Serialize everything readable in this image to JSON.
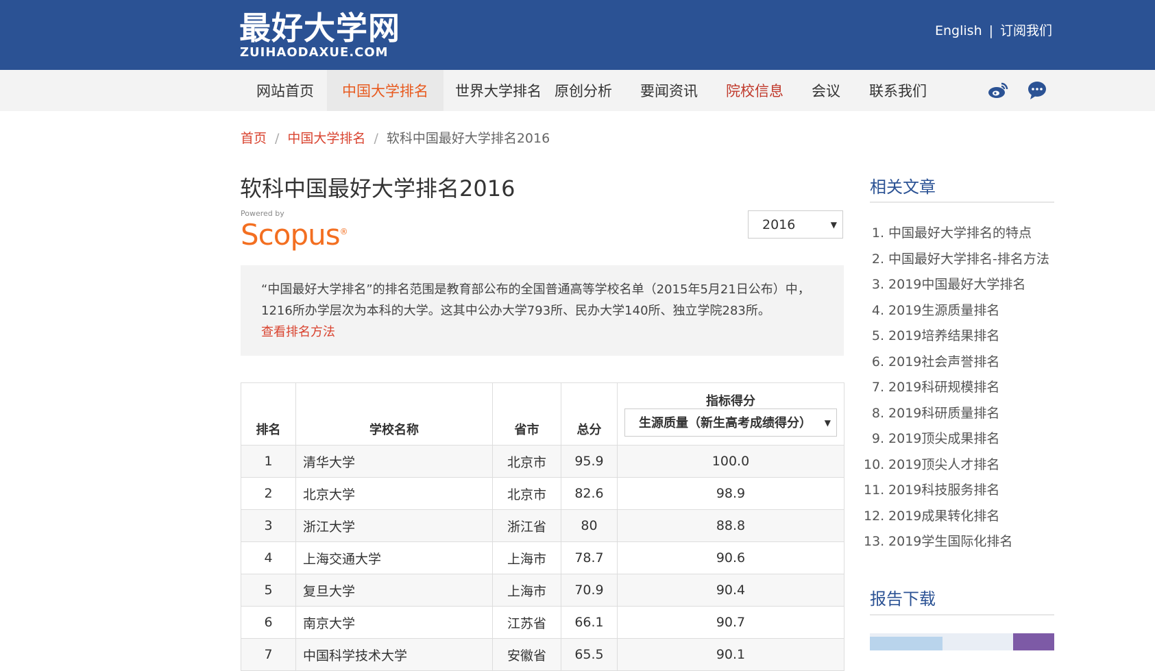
{
  "header": {
    "logo_cn": "最好大学网",
    "logo_en": "ZUIHAODAXUE.COM",
    "link_english": "English",
    "separator": "|",
    "link_subscribe": "订阅我们"
  },
  "nav": {
    "items": [
      "网站首页",
      "中国大学排名",
      "世界大学排名",
      "原创分析",
      "要闻资讯",
      "院校信息",
      "会议",
      "联系我们"
    ],
    "active_index": 1
  },
  "breadcrumb": {
    "home": "首页",
    "category": "中国大学排名",
    "current": "软科中国最好大学排名2016",
    "sep": "/"
  },
  "page": {
    "title": "软科中国最好大学排名2016",
    "powered_by": "Powered by",
    "scopus": "Scopus",
    "year_selected": "2016"
  },
  "intro": {
    "line1": "“中国最好大学排名”的排名范围是教育部公布的全国普通高等学校名单（2015年5月21日公布）中，",
    "line2": "1216所办学层次为本科的大学。这其中公办大学793所、民办大学140所、独立学院283所。",
    "method_link": "查看排名方法"
  },
  "table": {
    "headers": {
      "rank": "排名",
      "name": "学校名称",
      "province": "省市",
      "score": "总分",
      "indicator": "指标得分",
      "indicator_selected": "生源质量（新生高考成绩得分）"
    },
    "rows": [
      {
        "rank": "1",
        "name": "清华大学",
        "province": "北京市",
        "score": "95.9",
        "indicator": "100.0"
      },
      {
        "rank": "2",
        "name": "北京大学",
        "province": "北京市",
        "score": "82.6",
        "indicator": "98.9"
      },
      {
        "rank": "3",
        "name": "浙江大学",
        "province": "浙江省",
        "score": "80",
        "indicator": "88.8"
      },
      {
        "rank": "4",
        "name": "上海交通大学",
        "province": "上海市",
        "score": "78.7",
        "indicator": "90.6"
      },
      {
        "rank": "5",
        "name": "复旦大学",
        "province": "上海市",
        "score": "70.9",
        "indicator": "90.4"
      },
      {
        "rank": "6",
        "name": "南京大学",
        "province": "江苏省",
        "score": "66.1",
        "indicator": "90.7"
      },
      {
        "rank": "7",
        "name": "中国科学技术大学",
        "province": "安徽省",
        "score": "65.5",
        "indicator": "90.1"
      }
    ]
  },
  "sidebar": {
    "related_title": "相关文章",
    "related": [
      {
        "num": "1.",
        "title": "中国最好大学排名的特点"
      },
      {
        "num": "2.",
        "title": "中国最好大学排名-排名方法"
      },
      {
        "num": "3.",
        "title": "2019中国最好大学排名"
      },
      {
        "num": "4.",
        "title": "2019生源质量排名"
      },
      {
        "num": "5.",
        "title": "2019培养结果排名"
      },
      {
        "num": "6.",
        "title": "2019社会声誉排名"
      },
      {
        "num": "7.",
        "title": "2019科研规模排名"
      },
      {
        "num": "8.",
        "title": "2019科研质量排名"
      },
      {
        "num": "9.",
        "title": "2019顶尖成果排名"
      },
      {
        "num": "10.",
        "title": "2019顶尖人才排名"
      },
      {
        "num": "11.",
        "title": "2019科技服务排名"
      },
      {
        "num": "12.",
        "title": "2019成果转化排名"
      },
      {
        "num": "13.",
        "title": "2019学生国际化排名"
      }
    ],
    "report_title": "报告下载"
  },
  "icons": {
    "weibo": "weibo-icon",
    "wechat": "wechat-icon",
    "dropdown": "chevron-down-icon"
  },
  "colors": {
    "header_bg": "#2b5294",
    "accent_orange": "#e85a1f",
    "link_red": "#d9432f",
    "side_title": "#2b5294"
  }
}
